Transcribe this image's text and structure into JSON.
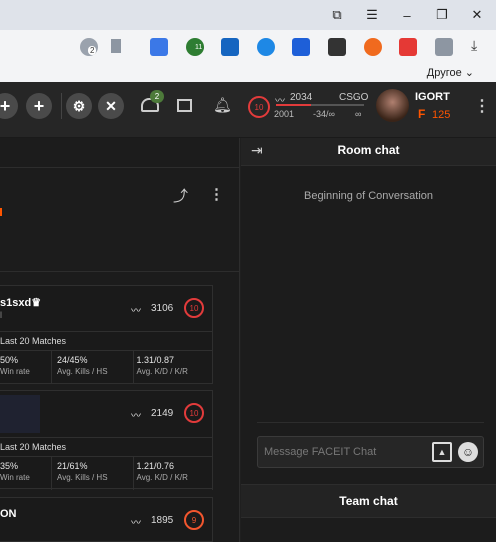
{
  "browser": {
    "bookmark_folder": "Другое",
    "badge_a": "2",
    "badge_b": "11"
  },
  "app": {
    "notif_count": "2",
    "elo": "2034",
    "game": "CSGO",
    "elo_low": "2001",
    "elo_delta": "-34/∞",
    "elo_high": "∞",
    "level": "10",
    "username": "IGORT",
    "points": "125"
  },
  "team": {
    "players": [
      {
        "name": "s1sxd",
        "elo": "3106",
        "level": "10",
        "level_color": "#e23b3b",
        "winrate": "50%",
        "kills_hs": "24/45%",
        "kd": "1.31/0.87"
      },
      {
        "name": "",
        "elo": "2149",
        "level": "10",
        "level_color": "#e23b3b",
        "winrate": "35%",
        "kills_hs": "21/61%",
        "kd": "1.21/0.76"
      },
      {
        "name": "ON",
        "elo": "1895",
        "level": "9",
        "level_color": "#f2562e"
      }
    ],
    "last20": "Last 20 Matches",
    "winrate_label": "Win rate",
    "kills_label": "Avg. Kills / HS",
    "kd_label": "Avg. K/D / K/R"
  },
  "chat": {
    "room_title": "Room chat",
    "beginning": "Beginning of Conversation",
    "placeholder": "Message FACEIT Chat",
    "team_title": "Team chat"
  },
  "colors": {
    "accent": "#ff5500",
    "level_red": "#e23b3b"
  }
}
